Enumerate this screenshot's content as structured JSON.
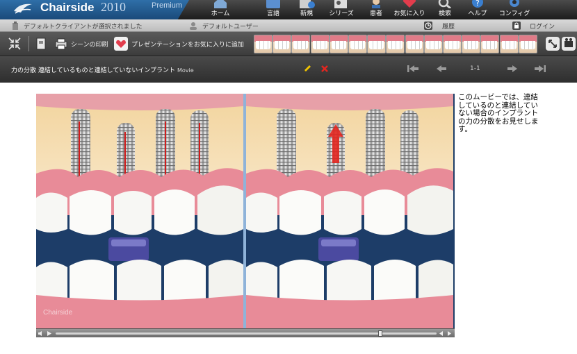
{
  "app": {
    "name": "Chairside",
    "year": "2010",
    "edition": "Premium"
  },
  "nav": {
    "items": [
      {
        "label": "ホーム",
        "icon": "home-icon"
      },
      {
        "label": "言語",
        "icon": "language-icon"
      },
      {
        "label": "新規",
        "icon": "new-icon"
      },
      {
        "label": "シリーズ",
        "icon": "series-icon"
      },
      {
        "label": "患者",
        "icon": "patient-icon"
      },
      {
        "label": "お気に入り",
        "icon": "favorite-icon"
      },
      {
        "label": "検索",
        "icon": "search-icon"
      },
      {
        "label": "ヘルプ",
        "icon": "help-icon"
      },
      {
        "label": "コンフィグ",
        "icon": "config-icon"
      }
    ]
  },
  "status": {
    "client_text": "デフォルトクライアントが選択されました",
    "user_text": "デフォルトユーザー",
    "history_label": "履歴",
    "login_label": "ログイン"
  },
  "toolbar": {
    "print_label": "シーンの印刷",
    "favorite_label": "プレゼンテーションをお気に入りに追加",
    "thumb_count": 15
  },
  "titlebar": {
    "title": "力の分散 連結しているものと連結していないインプラント",
    "type": "Movie",
    "page": "1-1"
  },
  "video": {
    "watermark": "Chairside"
  },
  "description": "このムービーでは、連結しているのと連結していない場合のインプラントの力の分散をお見せします。",
  "colors": {
    "accent": "#2f6fa8",
    "edit": "#f2c500",
    "delete": "#e3261f",
    "gum": "#e07b88",
    "video_bg": "#1d3d68"
  },
  "chart_data": null
}
